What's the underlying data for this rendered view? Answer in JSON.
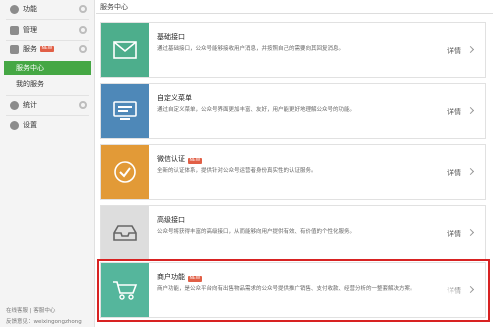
{
  "sidebar": {
    "items": [
      {
        "label": "功能"
      },
      {
        "label": "管理"
      },
      {
        "label": "服务",
        "badge": "NEW"
      },
      {
        "label": "统计"
      },
      {
        "label": "设置"
      }
    ],
    "sub_items": [
      {
        "label": "服务中心"
      },
      {
        "label": "我的服务"
      }
    ],
    "footer_links": "在线客服 | 客服中心",
    "footer_feedback": "反馈意见：weixingongzhong"
  },
  "main": {
    "title": "服务中心",
    "cards": [
      {
        "title": "基础接口",
        "desc": "通过基础接口，公众号能够接收用户消息，并按照自己的需要向其回复消息。",
        "link": "详情"
      },
      {
        "title": "自定义菜单",
        "desc": "通过自定义菜单，公众号界面更加丰富、友好，用户能更好地理解公众号的功能。",
        "link": "详情"
      },
      {
        "title": "微信认证",
        "badge": "NEW",
        "desc": "全新的认证体系，提供针对公众号运营者身份真实性的认证服务。",
        "link": "详情"
      },
      {
        "title": "高级接口",
        "desc": "公众号将获得丰富的高级接口，从而能够向用户提供有效、有价值的个性化服务。",
        "link": "详情"
      },
      {
        "title": "商户功能",
        "badge": "NEW",
        "desc": "商户功能，是公众平台向有出售物品需求的公众号提供推广销售、支付收款、经营分析的一整套解决方案。",
        "link": "详情"
      }
    ]
  },
  "colors": {
    "active_green": "#45a744",
    "icon_mail": "#4dae8c",
    "icon_menu": "#4e88b8",
    "icon_verify": "#e29a37",
    "icon_api": "#dddddd",
    "icon_shop": "#55b69c",
    "highlight_red": "#d82222",
    "badge_red": "#e15f46"
  },
  "icons": [
    "mail-icon",
    "menu-window-icon",
    "check-icon",
    "tray-icon",
    "cart-icon"
  ]
}
